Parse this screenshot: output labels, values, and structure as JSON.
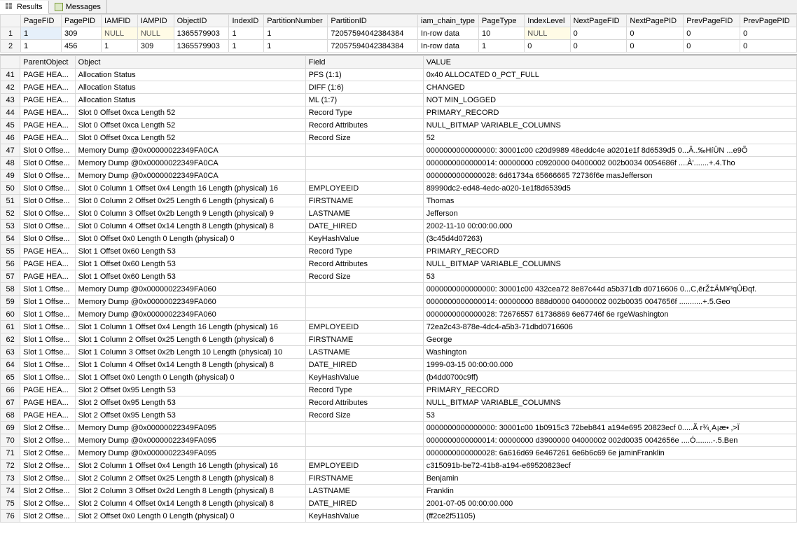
{
  "tabs": {
    "results": "Results",
    "messages": "Messages"
  },
  "upper": {
    "headers": [
      "PageFID",
      "PagePID",
      "IAMFID",
      "IAMPID",
      "ObjectID",
      "IndexID",
      "PartitionNumber",
      "PartitionID",
      "iam_chain_type",
      "PageType",
      "IndexLevel",
      "NextPageFID",
      "NextPagePID",
      "PrevPageFID",
      "PrevPagePID"
    ],
    "rows": [
      {
        "n": "1",
        "cells": [
          "1",
          "309",
          "NULL",
          "NULL",
          "1365579903",
          "1",
          "1",
          "72057594042384384",
          "In-row data",
          "10",
          "NULL",
          "0",
          "0",
          "0",
          "0"
        ],
        "null_idx": [
          2,
          3,
          10
        ],
        "sel": [
          0
        ]
      },
      {
        "n": "2",
        "cells": [
          "1",
          "456",
          "1",
          "309",
          "1365579903",
          "1",
          "1",
          "72057594042384384",
          "In-row data",
          "1",
          "0",
          "0",
          "0",
          "0",
          "0"
        ]
      }
    ]
  },
  "lower": {
    "headers": [
      "ParentObject",
      "Object",
      "Field",
      "VALUE"
    ],
    "rows": [
      {
        "n": "41",
        "c": [
          "PAGE HEA...",
          "Allocation Status",
          "PFS (1:1)",
          "0x40 ALLOCATED   0_PCT_FULL"
        ]
      },
      {
        "n": "42",
        "c": [
          "PAGE HEA...",
          "Allocation Status",
          "DIFF (1:6)",
          "CHANGED"
        ]
      },
      {
        "n": "43",
        "c": [
          "PAGE HEA...",
          "Allocation Status",
          "ML (1:7)",
          "NOT MIN_LOGGED"
        ]
      },
      {
        "n": "44",
        "c": [
          "PAGE HEA...",
          "Slot 0 Offset 0xca Length 52",
          "Record Type",
          "PRIMARY_RECORD"
        ]
      },
      {
        "n": "45",
        "c": [
          "PAGE HEA...",
          "Slot 0 Offset 0xca Length 52",
          "Record Attributes",
          " NULL_BITMAP VARIABLE_COLUMNS"
        ]
      },
      {
        "n": "46",
        "c": [
          "PAGE HEA...",
          "Slot 0 Offset 0xca Length 52",
          "Record Size",
          "52"
        ]
      },
      {
        "n": "47",
        "c": [
          "Slot 0 Offse...",
          "Memory Dump @0x00000022349FA0CA",
          "",
          "0000000000000000:   30001c00 c20d9989 48eddc4e a0201e1f 8d6539d5  0...Â..‰HíÜN  ...e9Õ"
        ]
      },
      {
        "n": "48",
        "c": [
          "Slot 0 Offse...",
          "Memory Dump @0x00000022349FA0CA",
          "",
          "0000000000000014:   00000000 c0920000 04000002 002b0034 0054686f  ....À'.......+.4.Tho"
        ]
      },
      {
        "n": "49",
        "c": [
          "Slot 0 Offse...",
          "Memory Dump @0x00000022349FA0CA",
          "",
          "0000000000000028:   6d61734a 65666665 72736f6e                    masJefferson"
        ]
      },
      {
        "n": "50",
        "c": [
          "Slot 0 Offse...",
          "Slot 0 Column 1 Offset 0x4 Length 16 Length (physical) 16",
          "EMPLOYEEID",
          "89990dc2-ed48-4edc-a020-1e1f8d6539d5"
        ]
      },
      {
        "n": "51",
        "c": [
          "Slot 0 Offse...",
          "Slot 0 Column 2 Offset 0x25 Length 6 Length (physical) 6",
          "FIRSTNAME",
          "Thomas"
        ]
      },
      {
        "n": "52",
        "c": [
          "Slot 0 Offse...",
          "Slot 0 Column 3 Offset 0x2b Length 9 Length (physical) 9",
          "LASTNAME",
          "Jefferson"
        ]
      },
      {
        "n": "53",
        "c": [
          "Slot 0 Offse...",
          "Slot 0 Column 4 Offset 0x14 Length 8 Length (physical) 8",
          "DATE_HIRED",
          "2002-11-10 00:00:00.000"
        ]
      },
      {
        "n": "54",
        "c": [
          "Slot 0 Offse...",
          "Slot 0 Offset 0x0 Length 0 Length (physical) 0",
          "KeyHashValue",
          "(3c45d4d07263)"
        ]
      },
      {
        "n": "55",
        "c": [
          "PAGE HEA...",
          "Slot 1 Offset 0x60 Length 53",
          "Record Type",
          "PRIMARY_RECORD"
        ]
      },
      {
        "n": "56",
        "c": [
          "PAGE HEA...",
          "Slot 1 Offset 0x60 Length 53",
          "Record Attributes",
          " NULL_BITMAP VARIABLE_COLUMNS"
        ]
      },
      {
        "n": "57",
        "c": [
          "PAGE HEA...",
          "Slot 1 Offset 0x60 Length 53",
          "Record Size",
          "53"
        ]
      },
      {
        "n": "58",
        "c": [
          "Slot 1 Offse...",
          "Memory Dump @0x00000022349FA060",
          "",
          "0000000000000000:   30001c00 432cea72 8e87c44d a5b371db d0716606  0...C,êrŽ‡ÄM¥³qÛÐqf."
        ]
      },
      {
        "n": "59",
        "c": [
          "Slot 1 Offse...",
          "Memory Dump @0x00000022349FA060",
          "",
          "0000000000000014:   00000000 888d0000 04000002 002b0035 0047656f  ...........+.5.Geo"
        ]
      },
      {
        "n": "60",
        "c": [
          "Slot 1 Offse...",
          "Memory Dump @0x00000022349FA060",
          "",
          "0000000000000028:   72676557 61736869 6e67746f 6e                 rgeWashington"
        ]
      },
      {
        "n": "61",
        "c": [
          "Slot 1 Offse...",
          "Slot 1 Column 1 Offset 0x4 Length 16 Length (physical) 16",
          "EMPLOYEEID",
          "72ea2c43-878e-4dc4-a5b3-71dbd0716606"
        ]
      },
      {
        "n": "62",
        "c": [
          "Slot 1 Offse...",
          "Slot 1 Column 2 Offset 0x25 Length 6 Length (physical) 6",
          "FIRSTNAME",
          "George"
        ]
      },
      {
        "n": "63",
        "c": [
          "Slot 1 Offse...",
          "Slot 1 Column 3 Offset 0x2b Length 10 Length (physical) 10",
          "LASTNAME",
          "Washington"
        ]
      },
      {
        "n": "64",
        "c": [
          "Slot 1 Offse...",
          "Slot 1 Column 4 Offset 0x14 Length 8 Length (physical) 8",
          "DATE_HIRED",
          "1999-03-15 00:00:00.000"
        ]
      },
      {
        "n": "65",
        "c": [
          "Slot 1 Offse...",
          "Slot 1 Offset 0x0 Length 0 Length (physical) 0",
          "KeyHashValue",
          "(b4dd0700c9ff)"
        ]
      },
      {
        "n": "66",
        "c": [
          "PAGE HEA...",
          "Slot 2 Offset 0x95 Length 53",
          "Record Type",
          "PRIMARY_RECORD"
        ]
      },
      {
        "n": "67",
        "c": [
          "PAGE HEA...",
          "Slot 2 Offset 0x95 Length 53",
          "Record Attributes",
          " NULL_BITMAP VARIABLE_COLUMNS"
        ]
      },
      {
        "n": "68",
        "c": [
          "PAGE HEA...",
          "Slot 2 Offset 0x95 Length 53",
          "Record Size",
          "53"
        ]
      },
      {
        "n": "69",
        "c": [
          "Slot 2 Offse...",
          "Memory Dump @0x00000022349FA095",
          "",
          "0000000000000000:   30001c00 1b0915c3 72beb841 a194e695 20823ecf  0.....Ã r¾¸A¡æ• ‚>Ï"
        ]
      },
      {
        "n": "70",
        "c": [
          "Slot 2 Offse...",
          "Memory Dump @0x00000022349FA095",
          "",
          "0000000000000014:   00000000 d3900000 04000002 002d0035 0042656e  ....Ó........-.5.Ben"
        ]
      },
      {
        "n": "71",
        "c": [
          "Slot 2 Offse...",
          "Memory Dump @0x00000022349FA095",
          "",
          "0000000000000028:   6a616d69 6e467261 6e6b6c69 6e                 jaminFranklin"
        ]
      },
      {
        "n": "72",
        "c": [
          "Slot 2 Offse...",
          "Slot 2 Column 1 Offset 0x4 Length 16 Length (physical) 16",
          "EMPLOYEEID",
          "c315091b-be72-41b8-a194-e69520823ecf"
        ]
      },
      {
        "n": "73",
        "c": [
          "Slot 2 Offse...",
          "Slot 2 Column 2 Offset 0x25 Length 8 Length (physical) 8",
          "FIRSTNAME",
          "Benjamin"
        ]
      },
      {
        "n": "74",
        "c": [
          "Slot 2 Offse...",
          "Slot 2 Column 3 Offset 0x2d Length 8 Length (physical) 8",
          "LASTNAME",
          "Franklin"
        ]
      },
      {
        "n": "75",
        "c": [
          "Slot 2 Offse...",
          "Slot 2 Column 4 Offset 0x14 Length 8 Length (physical) 8",
          "DATE_HIRED",
          "2001-07-05 00:00:00.000"
        ]
      },
      {
        "n": "76",
        "c": [
          "Slot 2 Offse...",
          "Slot 2 Offset 0x0 Length 0 Length (physical) 0",
          "KeyHashValue",
          "(ff2ce2f51105)"
        ]
      }
    ]
  }
}
